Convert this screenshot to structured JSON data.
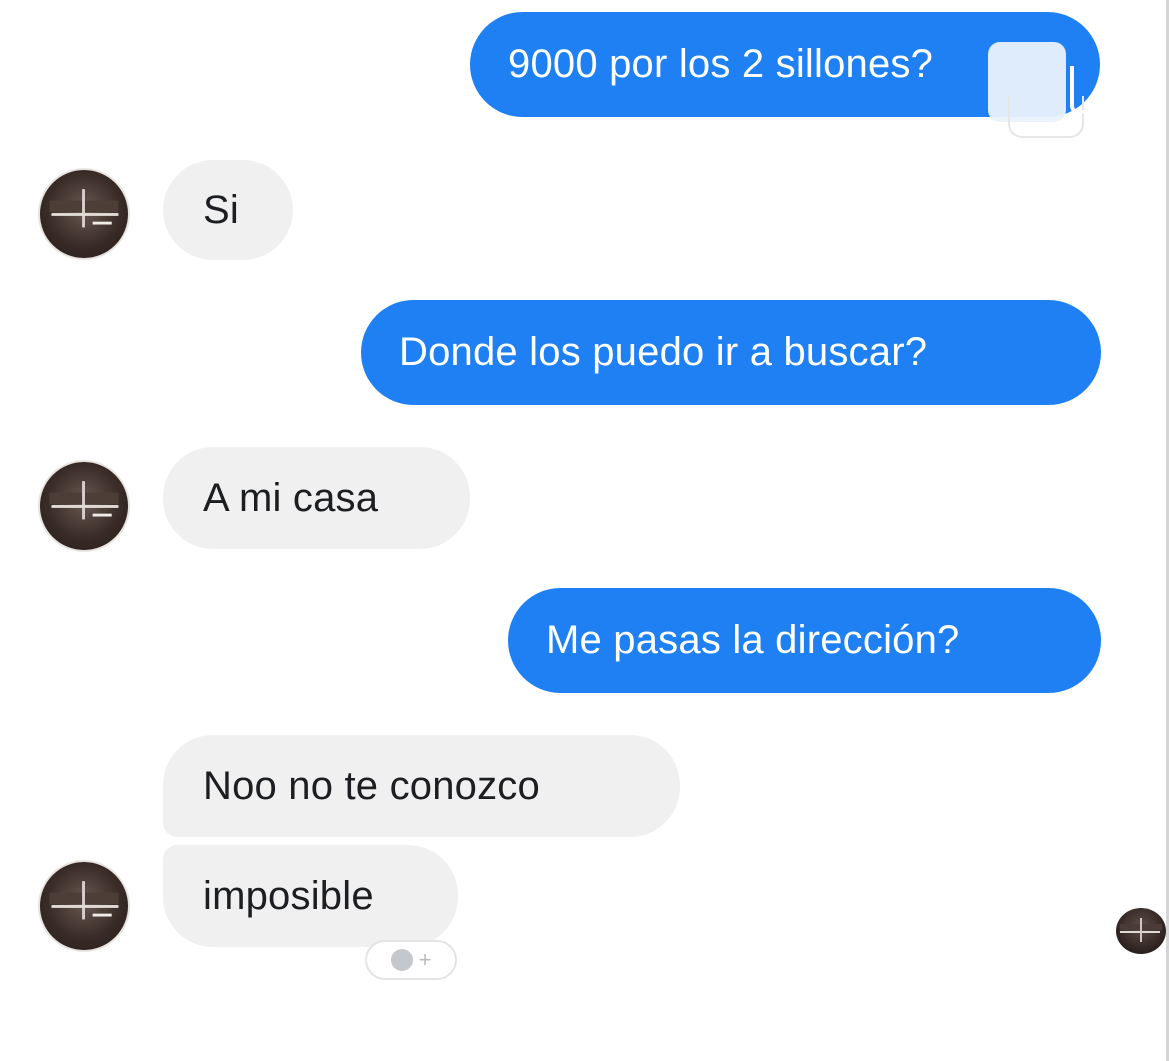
{
  "conversation": {
    "messages": [
      {
        "direction": "outgoing",
        "text": "9000 por los 2 sillones?"
      },
      {
        "direction": "incoming",
        "text": "Si"
      },
      {
        "direction": "outgoing",
        "text": "Donde los puedo ir a buscar?"
      },
      {
        "direction": "incoming",
        "text": "A mi casa"
      },
      {
        "direction": "outgoing",
        "text": "Me pasas la dirección?"
      },
      {
        "direction": "incoming",
        "text": "Noo no te conozco"
      },
      {
        "direction": "incoming",
        "text": "imposible"
      }
    ],
    "reaction_button": {
      "icon": "smiley-add-icon",
      "label": "+"
    },
    "colors": {
      "outgoing_bubble": "#1e80f3",
      "incoming_bubble": "#f0f0f0",
      "background": "#ffffff"
    }
  }
}
